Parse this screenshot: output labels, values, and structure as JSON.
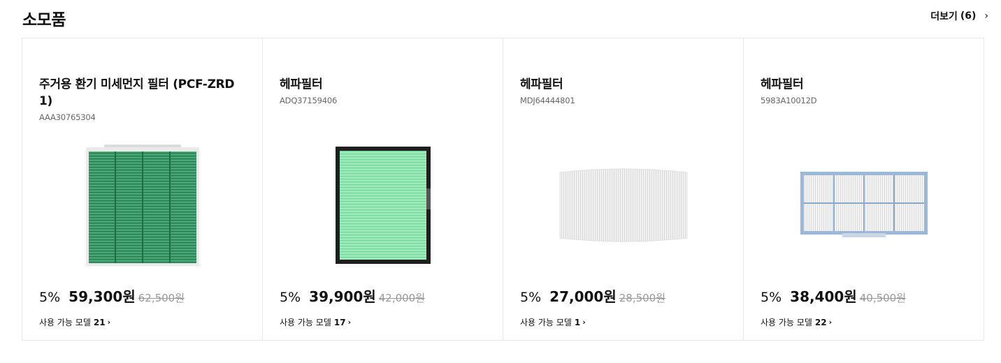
{
  "section": {
    "title": "소모품",
    "more_label": "더보기",
    "more_count": "(6)",
    "more_chevron": "›"
  },
  "products": [
    {
      "name": "주거용 환기 미세먼지 필터 (PCF-ZRD 1)",
      "sku": "AAA30765304",
      "discount": "5%",
      "price": "59,300원",
      "original_price": "62,500원",
      "models_label": "사용 가능 모델",
      "models_count": "21",
      "chevron": "›",
      "image_icon": "green-ventilation-filter-image"
    },
    {
      "name": "헤파필터",
      "sku": "ADQ37159406",
      "discount": "5%",
      "price": "39,900원",
      "original_price": "42,000원",
      "models_label": "사용 가능 모델",
      "models_count": "17",
      "chevron": "›",
      "image_icon": "green-hepa-filter-image"
    },
    {
      "name": "헤파필터",
      "sku": "MDJ64444801",
      "discount": "5%",
      "price": "27,000원",
      "original_price": "28,500원",
      "models_label": "사용 가능 모델",
      "models_count": "1",
      "chevron": "›",
      "image_icon": "white-curved-hepa-filter-image"
    },
    {
      "name": "헤파필터",
      "sku": "5983A10012D",
      "discount": "5%",
      "price": "38,400원",
      "original_price": "40,500원",
      "models_label": "사용 가능 모델",
      "models_count": "22",
      "chevron": "›",
      "image_icon": "blue-frame-hepa-filter-image"
    }
  ],
  "colors": {
    "green_filter": "#2f8a5a",
    "light_green_filter": "#7fe0a8",
    "blue_frame": "#8fb0d4",
    "strike_price": "#999999"
  }
}
